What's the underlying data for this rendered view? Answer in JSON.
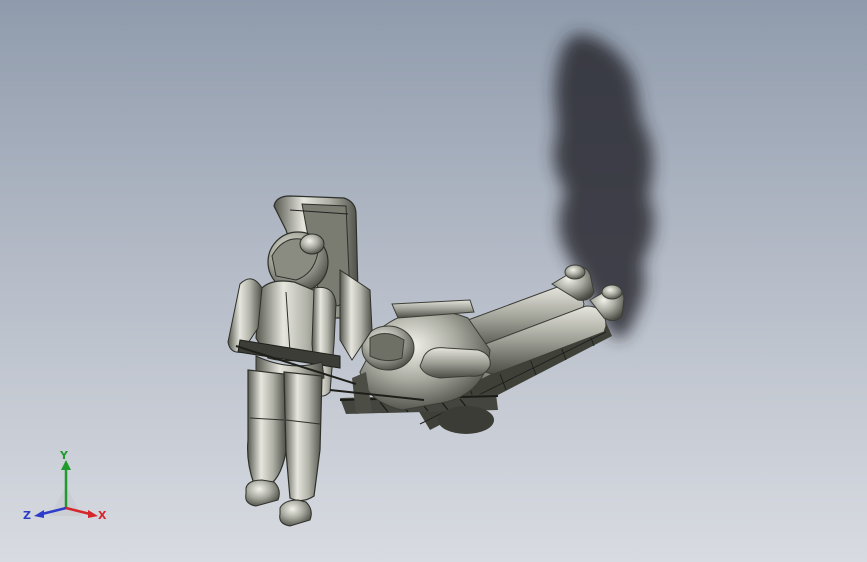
{
  "viewport": {
    "background_top": "#8f9bac",
    "background_bottom": "#d8dbe1"
  },
  "model": {
    "description_icon": "astronaut-carrying-astronaut-on-stretcher-model",
    "metal_light": "#e4e4dc",
    "metal_mid": "#a5a69c",
    "metal_dark": "#55574f",
    "shadow_color": "#2a2c30"
  },
  "triad": {
    "x_label": "X",
    "y_label": "Y",
    "z_label": "Z",
    "x_color": "#d4262b",
    "y_color": "#1f9b2d",
    "z_color": "#2c3ec9"
  }
}
